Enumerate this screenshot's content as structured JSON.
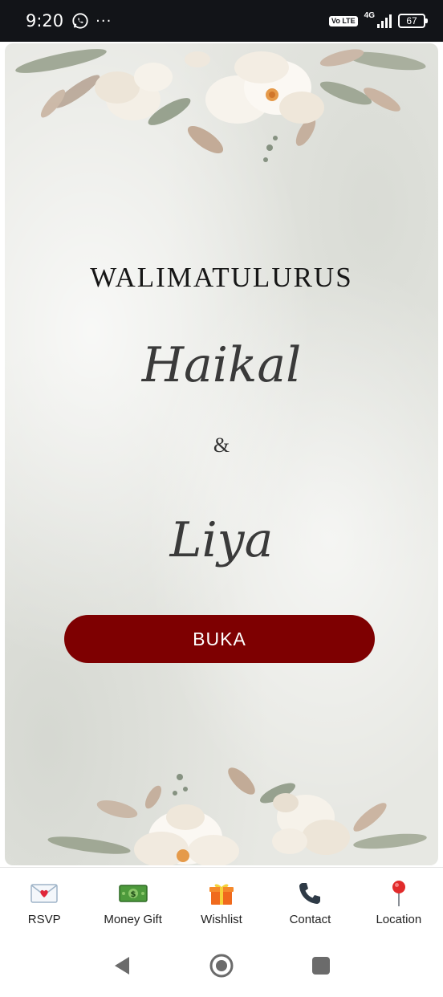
{
  "status_bar": {
    "time": "9:20",
    "more": "···",
    "volte": "Vo LTE",
    "network": "4G",
    "battery": "67"
  },
  "invitation": {
    "title": "WALIMATULURUS",
    "groom": "Haikal",
    "ampersand": "&",
    "bride": "Liya",
    "open_label": "BUKA",
    "accent_color": "#7e0001"
  },
  "bottom_nav": {
    "items": [
      {
        "label": "RSVP",
        "icon": "love-letter-icon"
      },
      {
        "label": "Money Gift",
        "icon": "money-icon"
      },
      {
        "label": "Wishlist",
        "icon": "gift-icon"
      },
      {
        "label": "Contact",
        "icon": "phone-icon"
      },
      {
        "label": "Location",
        "icon": "pin-icon"
      }
    ]
  }
}
